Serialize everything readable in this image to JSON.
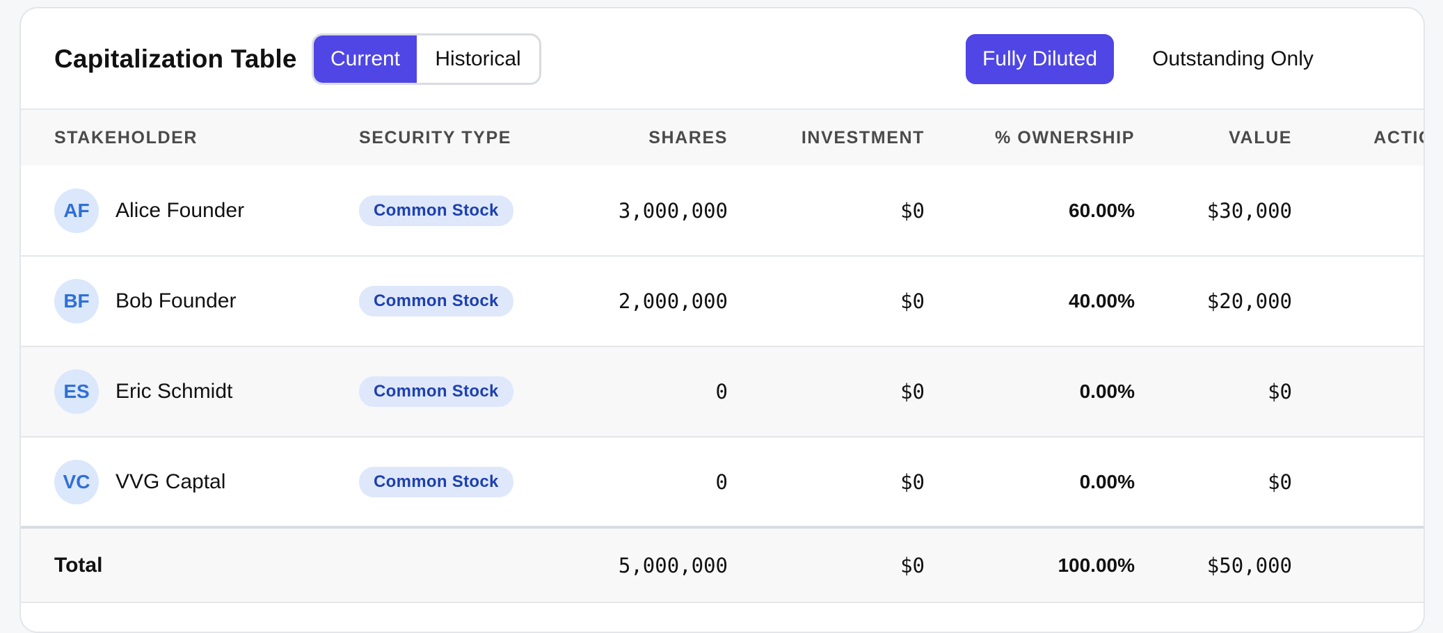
{
  "header": {
    "title": "Capitalization Table",
    "time_toggle": {
      "current": "Current",
      "historical": "Historical",
      "selected": "Current"
    },
    "view_toggle": {
      "fully_diluted": "Fully Diluted",
      "outstanding_only": "Outstanding Only",
      "selected": "Fully Diluted"
    }
  },
  "table": {
    "columns": {
      "stakeholder": "STAKEHOLDER",
      "security_type": "SECURITY TYPE",
      "shares": "SHARES",
      "investment": "INVESTMENT",
      "ownership": "% OWNERSHIP",
      "value": "VALUE",
      "actions": "ACTIONS"
    },
    "rows": [
      {
        "initials": "AF",
        "name": "Alice Founder",
        "security_type": "Common Stock",
        "shares": "3,000,000",
        "investment": "$0",
        "ownership": "60.00%",
        "value": "$30,000"
      },
      {
        "initials": "BF",
        "name": "Bob Founder",
        "security_type": "Common Stock",
        "shares": "2,000,000",
        "investment": "$0",
        "ownership": "40.00%",
        "value": "$20,000"
      },
      {
        "initials": "ES",
        "name": "Eric Schmidt",
        "security_type": "Common Stock",
        "shares": "0",
        "investment": "$0",
        "ownership": "0.00%",
        "value": "$0"
      },
      {
        "initials": "VC",
        "name": "VVG Captal",
        "security_type": "Common Stock",
        "shares": "0",
        "investment": "$0",
        "ownership": "0.00%",
        "value": "$0"
      }
    ],
    "total": {
      "label": "Total",
      "shares": "5,000,000",
      "investment": "$0",
      "ownership": "100.00%",
      "value": "$50,000"
    }
  },
  "colors": {
    "accent": "#4f46e5",
    "avatar_bg": "#dbe7fb",
    "avatar_text": "#2f6fd6",
    "badge_bg": "#dfe8fb",
    "badge_text": "#1e40af"
  }
}
